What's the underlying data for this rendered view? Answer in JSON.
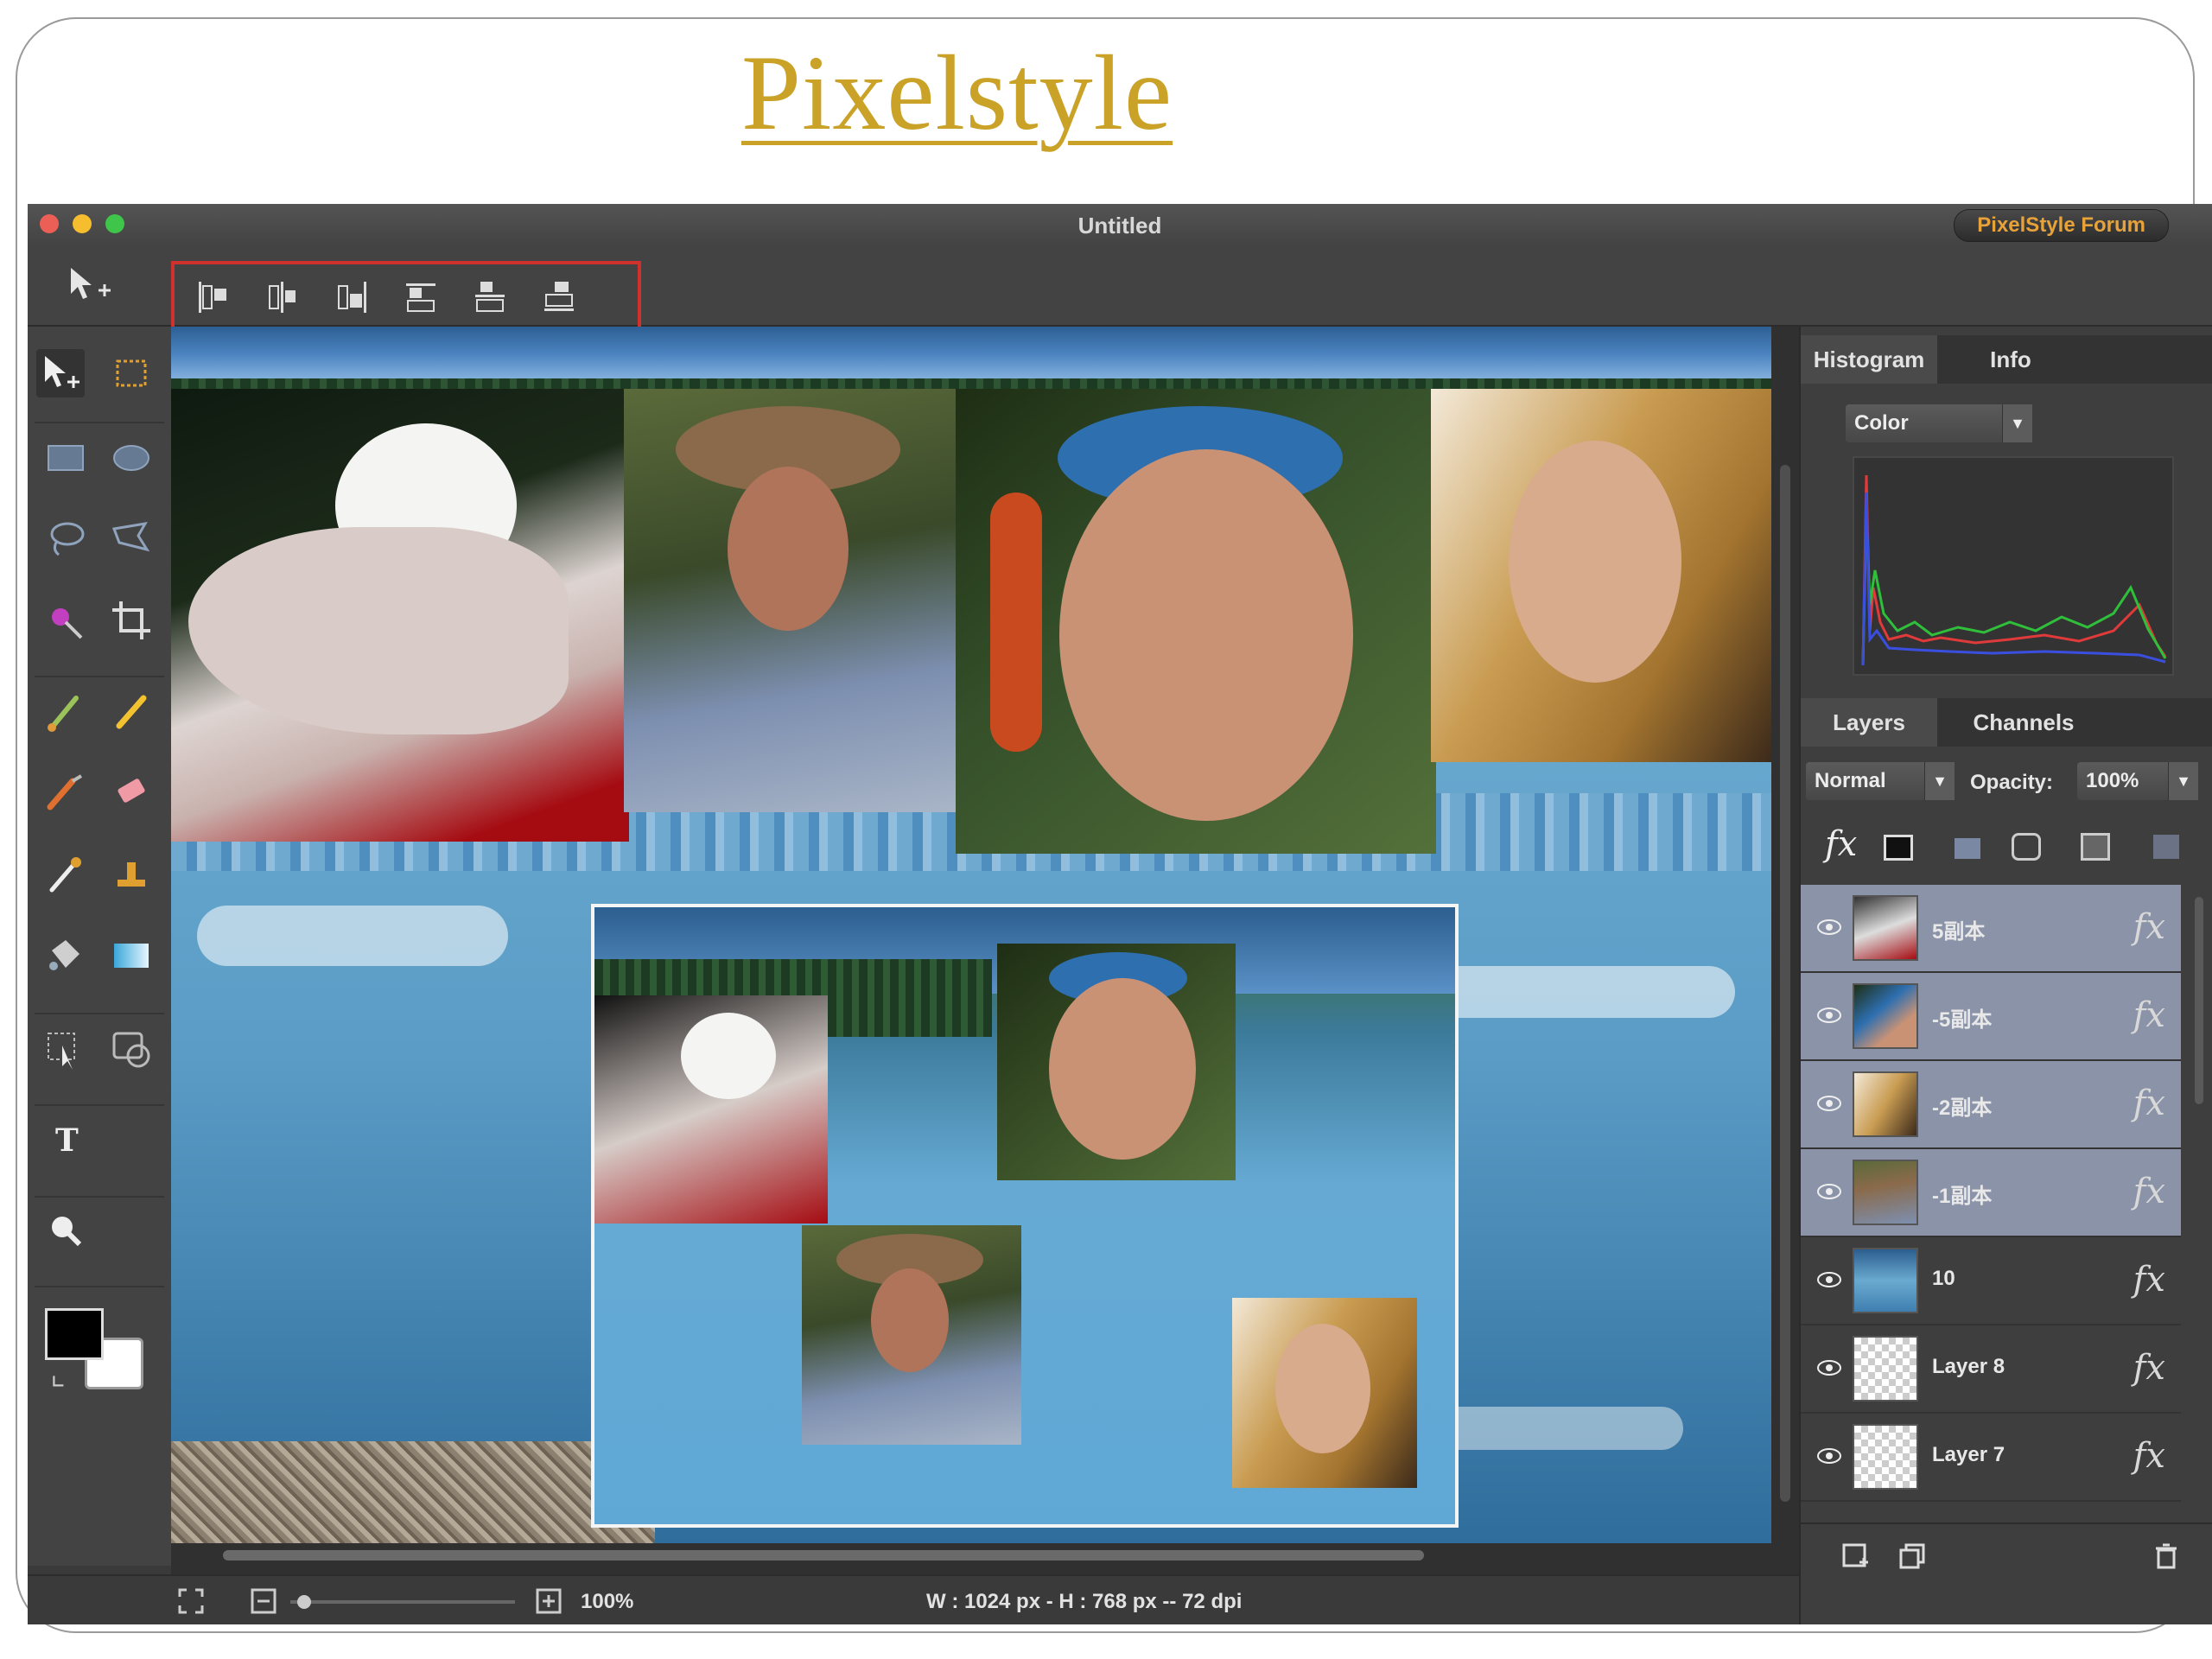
{
  "slide": {
    "title": "Pixelstyle"
  },
  "window": {
    "title": "Untitled",
    "forum_button": "PixelStyle Forum"
  },
  "colors": {
    "title_gold": "#c9a227",
    "close": "#ec5f56",
    "minimize": "#f6bd2e",
    "zoom": "#3fc64a",
    "highlight_red": "#d0312d"
  },
  "toolbar": {
    "align_buttons": [
      "align-left-icon",
      "align-center-horizontal-icon",
      "align-right-icon",
      "align-top-icon",
      "align-middle-vertical-icon",
      "align-bottom-icon"
    ]
  },
  "histogram_panel": {
    "tabs": [
      "Histogram",
      "Info"
    ],
    "active_tab": "Histogram",
    "channel": "Color"
  },
  "layers_panel": {
    "tabs": [
      "Layers",
      "Channels"
    ],
    "active_tab": "Layers",
    "blend_mode": "Normal",
    "opacity_label": "Opacity:",
    "opacity_value": "100%",
    "fx_symbol": "fx",
    "layers": [
      {
        "name": "5副本",
        "selected": true
      },
      {
        "name": "-5副本",
        "selected": true
      },
      {
        "name": "-2副本",
        "selected": true
      },
      {
        "name": "-1副本",
        "selected": true
      },
      {
        "name": "10",
        "selected": false
      },
      {
        "name": "Layer 8",
        "selected": false
      },
      {
        "name": "Layer 7",
        "selected": false
      }
    ]
  },
  "status": {
    "zoom": "100%",
    "dimensions": "W : 1024 px  -  H : 768 px  --  72 dpi"
  }
}
